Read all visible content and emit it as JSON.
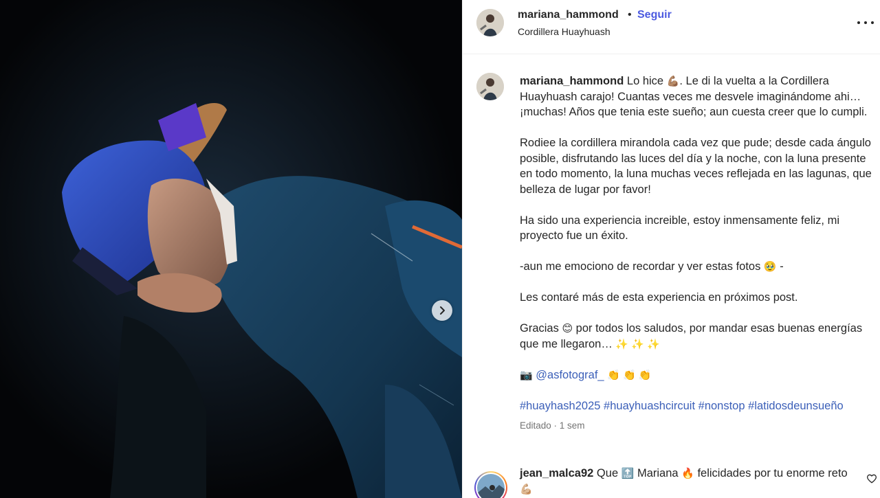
{
  "post": {
    "username": "mariana_hammond",
    "separator": "•",
    "follow_label": "Seguir",
    "location": "Cordillera Huayhuash",
    "more_icon": "more-horizontal-icon",
    "next_icon": "chevron-right-icon"
  },
  "caption": {
    "username": "mariana_hammond",
    "p1_a": "Lo hice ",
    "p1_emoji": "💪🏽",
    "p1_b": ". Le di la vuelta a la Cordillera Huayhuash carajo! Cuantas veces me desvele imaginándome ahi… ¡muchas! Años que tenia este sueño; aun cuesta creer que lo cumpli.",
    "p2": "Rodiee la cordillera mirandola cada vez que pude; desde cada ángulo posible, disfrutando las luces del día y la noche, con la luna presente en todo momento, la luna muchas veces reflejada en las lagunas, que belleza de lugar por favor!",
    "p3": "Ha sido una experiencia increible, estoy inmensamente feliz, mi proyecto fue un éxito.",
    "p4_a": "-aun me emociono de recordar y ver estas fotos ",
    "p4_emoji": "🥹",
    "p4_b": " -",
    "p5": "Les contaré más de esta experiencia en próximos post.",
    "p6_a": "Gracias ",
    "p6_emoji": "😊",
    "p6_b": "  por todos los saludos, por mandar esas buenas energías que me llegaron… ",
    "p6_emoji2": "✨ ✨ ✨",
    "p7_emoji": "📷",
    "p7_mention": "@asfotograf_",
    "p7_emoji2": "👏 👏 👏",
    "hashtags": [
      "#huayhash2025",
      "#huayhuashcircuit",
      "#nonstop",
      "#latidosdeunsueño"
    ],
    "meta": "Editado · 1 sem"
  },
  "comment": {
    "username": "jean_malca92",
    "text_a": " Que ",
    "emoji_a": "🔝",
    "text_b": " Mariana ",
    "emoji_b": "🔥",
    "text_c": "  felicidades por tu enorme reto ",
    "emoji_c": "💪🏼",
    "heart_icon": "heart-outline-icon"
  }
}
